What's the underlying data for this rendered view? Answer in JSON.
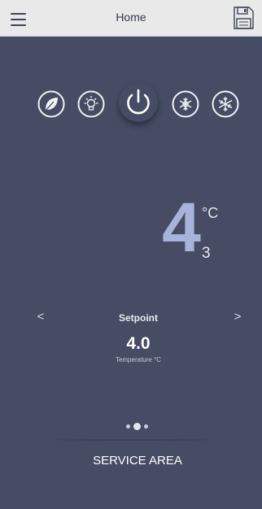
{
  "header": {
    "title": "Home",
    "menu_icon": "hamburger-menu-icon",
    "save_icon": "floppy-disk-save-icon"
  },
  "modes": [
    {
      "name": "eco",
      "icon": "leaf-icon"
    },
    {
      "name": "light",
      "icon": "light-bulb-icon"
    },
    {
      "name": "power",
      "icon": "power-icon"
    },
    {
      "name": "defrost",
      "icon": "snowflake-circle-icon"
    },
    {
      "name": "freeze",
      "icon": "snowflake-icon"
    }
  ],
  "temperature": {
    "value": "4",
    "unit": "°C",
    "decimal": "3"
  },
  "setpoint": {
    "label": "Setpoint",
    "value": "4.0",
    "caption": "Temperature °C",
    "prev_icon": "chevron-left-icon",
    "next_icon": "chevron-right-icon",
    "prev_glyph": "<",
    "next_glyph": ">"
  },
  "pager": {
    "page_count": 3,
    "active_index": 1
  },
  "footer": {
    "service_label": "SERVICE AREA"
  },
  "colors": {
    "background": "#454c63",
    "header": "#e9e9ea",
    "temperature_digit": "#a7b3d8",
    "text": "#ffffff"
  }
}
